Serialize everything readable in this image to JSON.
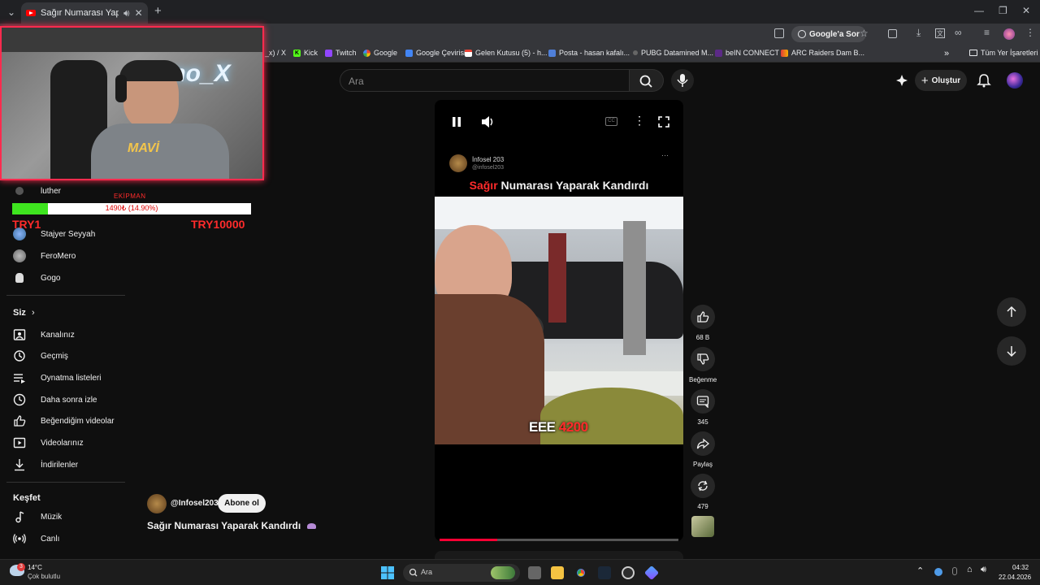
{
  "browser": {
    "tab_title": "Sağır Numarası Yaparak Ka",
    "bookmarks": [
      "_x) / X",
      "Kick",
      "Twitch",
      "Google",
      "Google Çevirisi",
      "Gelen Kutusu (5) - h...",
      "Posta - hasan kafalı...",
      "PUBG Datamined M...",
      "beIN CONNECT",
      "ARC Raiders Dam B..."
    ],
    "all_bookmarks": "Tüm Yer İşaretleri",
    "google_sor": "Google'a Sor"
  },
  "header": {
    "search_placeholder": "Ara",
    "create_label": "Oluştur"
  },
  "sidebar": {
    "subscriptions": [
      "luther",
      "Stajyer Seyyah",
      "FeroMero",
      "Gogo"
    ],
    "you_heading": "Siz",
    "you_items": [
      "Kanalınız",
      "Geçmiş",
      "Oynatma listeleri",
      "Daha sonra izle",
      "Beğendiğim videolar",
      "Videolarınız",
      "İndirilenler"
    ],
    "explore_heading": "Keşfet",
    "explore_items": [
      "Müzik",
      "Canlı"
    ]
  },
  "webcam": {
    "wall_text": "mo_X",
    "shirt_text": "MAVİ"
  },
  "overlay": {
    "equip_label": "EKİPMAN",
    "progress_text": "1490₺ (14.90%)",
    "progress_fraction": 0.149,
    "start_label": "TRY1",
    "goal_label": "TRY10000"
  },
  "video": {
    "channel_name": "İnfosel 203",
    "channel_handle": "@infosel203",
    "title_red": "Sağır",
    "title_rest": " Numarası Yaparak Kandırdı",
    "caption_white": "EEE ",
    "caption_red": "4200",
    "playback_fraction": 0.24
  },
  "actions": {
    "like_count": "68 B",
    "dislike_label": "Beğenme",
    "comment_count": "345",
    "share_label": "Paylaş",
    "remix_count": "479"
  },
  "below": {
    "channel_handle": "@Infosel203",
    "subscribe_label": "Abone ol",
    "title": "Sağır Numarası Yaparak Kandırdı"
  },
  "taskbar": {
    "weather_temp": "14°C",
    "weather_desc": "Çok bulutlu",
    "weather_badge": "3",
    "search_placeholder": "Ara",
    "time": "04:32",
    "date": "22.04.2026"
  }
}
